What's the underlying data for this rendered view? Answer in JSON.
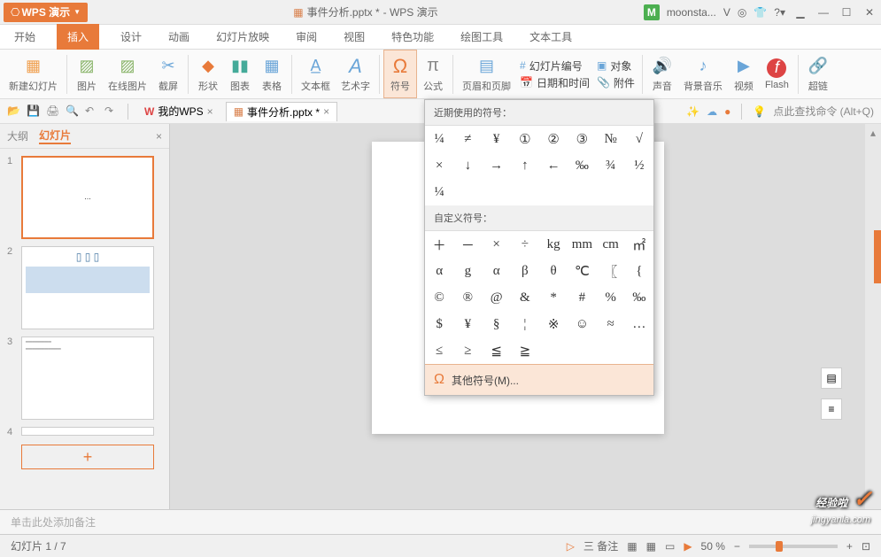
{
  "title": {
    "app_name": "WPS 演示",
    "doc_name": "事件分析.pptx *",
    "suffix": "- WPS 演示",
    "user": "moonsta..."
  },
  "menu": {
    "items": [
      "开始",
      "插入",
      "设计",
      "动画",
      "幻灯片放映",
      "审阅",
      "视图",
      "特色功能",
      "绘图工具",
      "文本工具"
    ],
    "active": 1
  },
  "ribbon": {
    "new_slide": "新建幻灯片",
    "image": "图片",
    "online_image": "在线图片",
    "screenshot": "截屏",
    "shape": "形状",
    "chart": "图表",
    "table": "表格",
    "textbox": "文本框",
    "wordart": "艺术字",
    "symbol": "符号",
    "formula": "公式",
    "header_footer": "页眉和页脚",
    "slide_number": "幻灯片编号",
    "object": "对象",
    "datetime": "日期和时间",
    "attachment": "附件",
    "sound": "声音",
    "bgmusic": "背景音乐",
    "video": "视频",
    "flash": "Flash",
    "link": "超链"
  },
  "tabs": {
    "mywps": "我的WPS",
    "doc": "事件分析.pptx *"
  },
  "search_hint": "点此查找命令 (Alt+Q)",
  "sidebar": {
    "outline": "大纲",
    "slides": "幻灯片"
  },
  "dropdown": {
    "recent_header": "近期使用的符号：",
    "recent": [
      "¼",
      "≠",
      "¥",
      "①",
      "②",
      "③",
      "№",
      "√",
      "×",
      "↓",
      "→",
      "↑",
      "←",
      "‰",
      "¾",
      "½",
      "¼"
    ],
    "custom_header": "自定义符号：",
    "custom": [
      "＋",
      "－",
      "×",
      "÷",
      "kg",
      "mm",
      "cm",
      "㎡",
      "α",
      "g",
      "α",
      "β",
      "θ",
      "℃",
      "〖",
      "{",
      "©",
      "®",
      "@",
      "&",
      "*",
      "#",
      "%",
      "‰",
      "$",
      "¥",
      "§",
      "¦",
      "※",
      "☺",
      "≈",
      "…",
      "≤",
      "≥",
      "≦",
      "≧"
    ],
    "more": "其他符号(M)..."
  },
  "notes_hint": "单击此处添加备注",
  "status": {
    "slide": "幻灯片 1 / 7",
    "notes": "备注",
    "zoom": "50 %"
  },
  "watermark": {
    "main": "经验啦",
    "sub": "jingyanla.com"
  },
  "thumb_labels": [
    "1",
    "2",
    "3",
    "4"
  ]
}
